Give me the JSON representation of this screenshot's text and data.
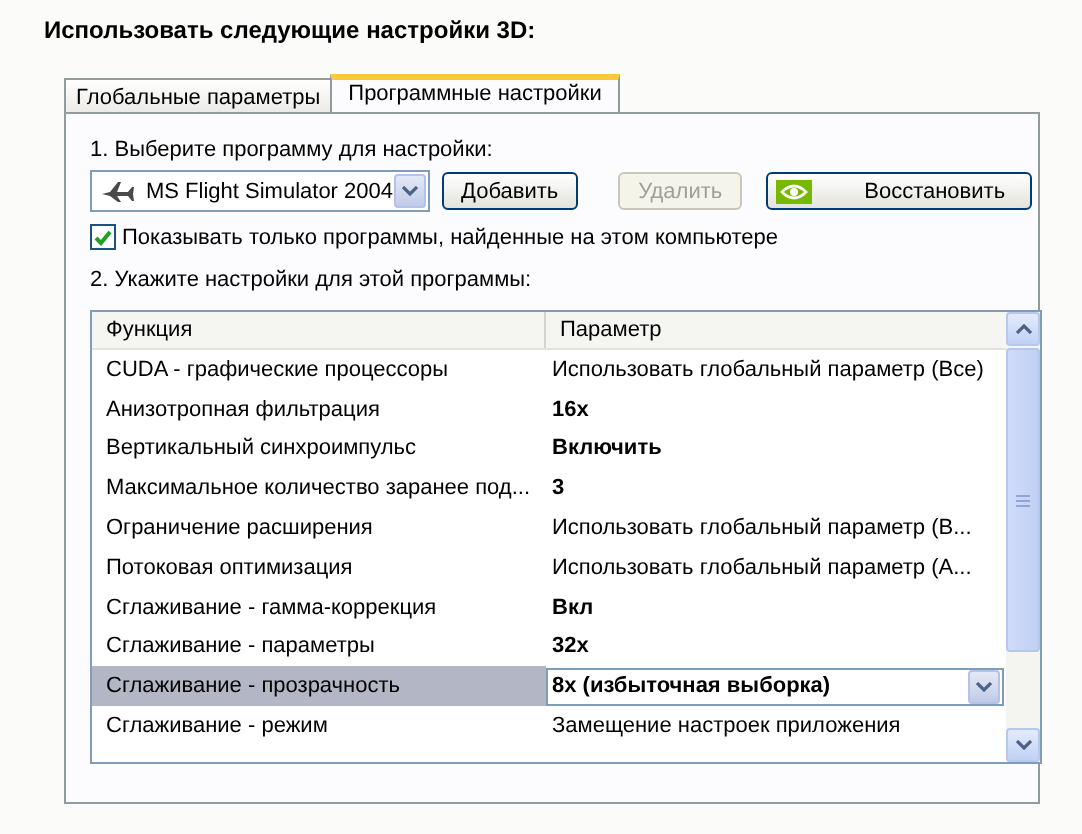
{
  "heading": "Использовать следующие настройки 3D:",
  "tabs": [
    {
      "label": "Глобальные параметры",
      "selected": false
    },
    {
      "label": "Программные настройки",
      "selected": true
    }
  ],
  "step1": "1. Выберите программу для настройки:",
  "program": {
    "value": "MS Flight Simulator 2004"
  },
  "buttons": [
    {
      "label": "Добавить",
      "disabled": false,
      "kind": "plain"
    },
    {
      "label": "Удалить",
      "disabled": true,
      "kind": "plain"
    },
    {
      "label": "Восстановить",
      "disabled": false,
      "kind": "logo"
    }
  ],
  "filter": {
    "label": "Показывать только программы, найденные на этом компьютере",
    "checked": true
  },
  "step2": "2. Укажите настройки для этой программы:",
  "table": {
    "columns": [
      "Функция",
      "Параметр"
    ],
    "rows": [
      {
        "function": "CUDA - графические процессоры",
        "value": "Использовать глобальный параметр (Все)",
        "overridden": false,
        "selected": false
      },
      {
        "function": "Анизотропная фильтрация",
        "value": "16x",
        "overridden": true,
        "selected": false
      },
      {
        "function": "Вертикальный синхроимпульс",
        "value": "Включить",
        "overridden": true,
        "selected": false
      },
      {
        "function": "Максимальное количество заранее под...",
        "value": "3",
        "overridden": true,
        "selected": false
      },
      {
        "function": "Ограничение расширения",
        "value": "Использовать глобальный параметр (В...",
        "overridden": false,
        "selected": false
      },
      {
        "function": "Потоковая оптимизация",
        "value": "Использовать глобальный параметр (А...",
        "overridden": false,
        "selected": false
      },
      {
        "function": "Сглаживание - гамма-коррекция",
        "value": "Вкл",
        "overridden": true,
        "selected": false
      },
      {
        "function": "Сглаживание - параметры",
        "value": "32x",
        "overridden": true,
        "selected": false
      },
      {
        "function": "Сглаживание - прозрачность",
        "value": "8x (избыточная выборка)",
        "overridden": true,
        "selected": true
      },
      {
        "function": "Сглаживание - режим",
        "value": "Замещение настроек приложения",
        "overridden": false,
        "selected": false
      }
    ]
  }
}
